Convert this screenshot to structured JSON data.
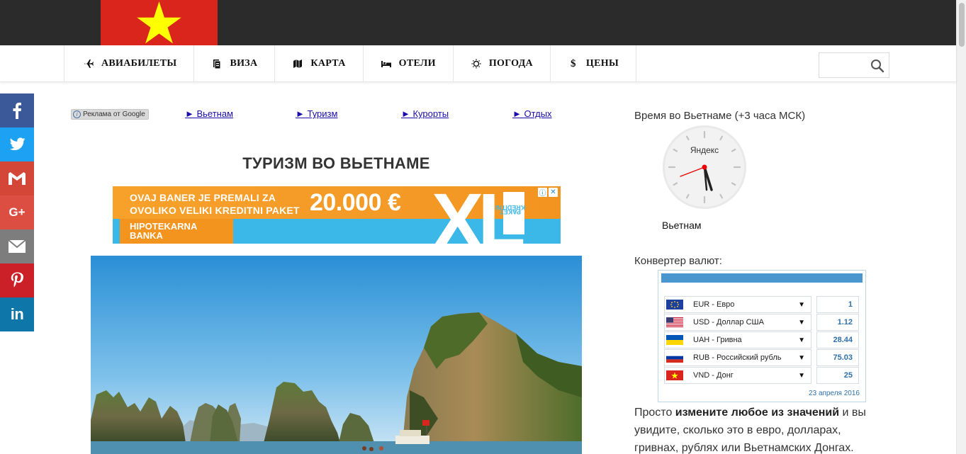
{
  "header": {
    "flag_icon": "vietnam-flag"
  },
  "nav": {
    "items": [
      {
        "label": "АВИАБИЛЕТЫ",
        "icon": "plane-icon"
      },
      {
        "label": "ВИЗА",
        "icon": "passport-icon"
      },
      {
        "label": "КАРТА",
        "icon": "map-icon"
      },
      {
        "label": "ОТЕЛИ",
        "icon": "bed-icon"
      },
      {
        "label": "ПОГОДА",
        "icon": "sun-icon"
      },
      {
        "label": "ЦЕНЫ",
        "icon": "dollar-icon"
      }
    ],
    "search_placeholder": ""
  },
  "social": {
    "buttons": [
      "facebook-icon",
      "twitter-icon",
      "gmail-icon",
      "google-plus-icon",
      "email-icon",
      "pinterest-icon",
      "linkedin-icon"
    ],
    "labels": {
      "gplus": "G+",
      "linkedin": "in"
    }
  },
  "ads": {
    "adchoice_label": "Реклама от Google",
    "links": [
      "► Вьетнам",
      "► Туризм",
      "► Курорты",
      "► Отдых"
    ]
  },
  "main": {
    "title": "ТУРИЗМ ВО ВЬЕТНАМЕ"
  },
  "banner": {
    "line1": "OVAJ BANER JE PREMALI ZA",
    "line2": "OVOLIKO VELIKI KREDITNI PAKET",
    "amount": "20.000 €",
    "logo_line1": "HIPOTEKARNA",
    "logo_line2": "BANKA",
    "xl": "XL",
    "paket_line1": "KREDITNI",
    "paket_line2": "PAKET"
  },
  "sidebar": {
    "time_title": "Время во Вьетнаме (+3 часа МСК)",
    "clock_brand": "Яндекс",
    "clock_caption": "Вьетнам",
    "converter_title": "Конвертер валют:",
    "converter": {
      "rows": [
        {
          "currency": "EUR - Евро",
          "value": "1",
          "flag": "eu"
        },
        {
          "currency": "USD - Доллар США",
          "value": "1.12",
          "flag": "us"
        },
        {
          "currency": "UAH - Гривна",
          "value": "28.44",
          "flag": "ua"
        },
        {
          "currency": "RUB - Российский рубль",
          "value": "75.03",
          "flag": "ru"
        },
        {
          "currency": "VND - Донг",
          "value": "25",
          "flag": "vn"
        }
      ],
      "arrow": "▼",
      "date": "23 апреля 2016"
    },
    "text_pre": "Просто ",
    "text_bold": "измените любое из значений",
    "text_post": " и вы увидите, сколько это в евро, долларах, гривнах, рублях или Вьетнамских Донгах."
  },
  "colors": {
    "topbar": "#2b2b2b",
    "flag_red": "#da251d",
    "flag_star": "#ffff00",
    "link": "#1a0dab"
  }
}
